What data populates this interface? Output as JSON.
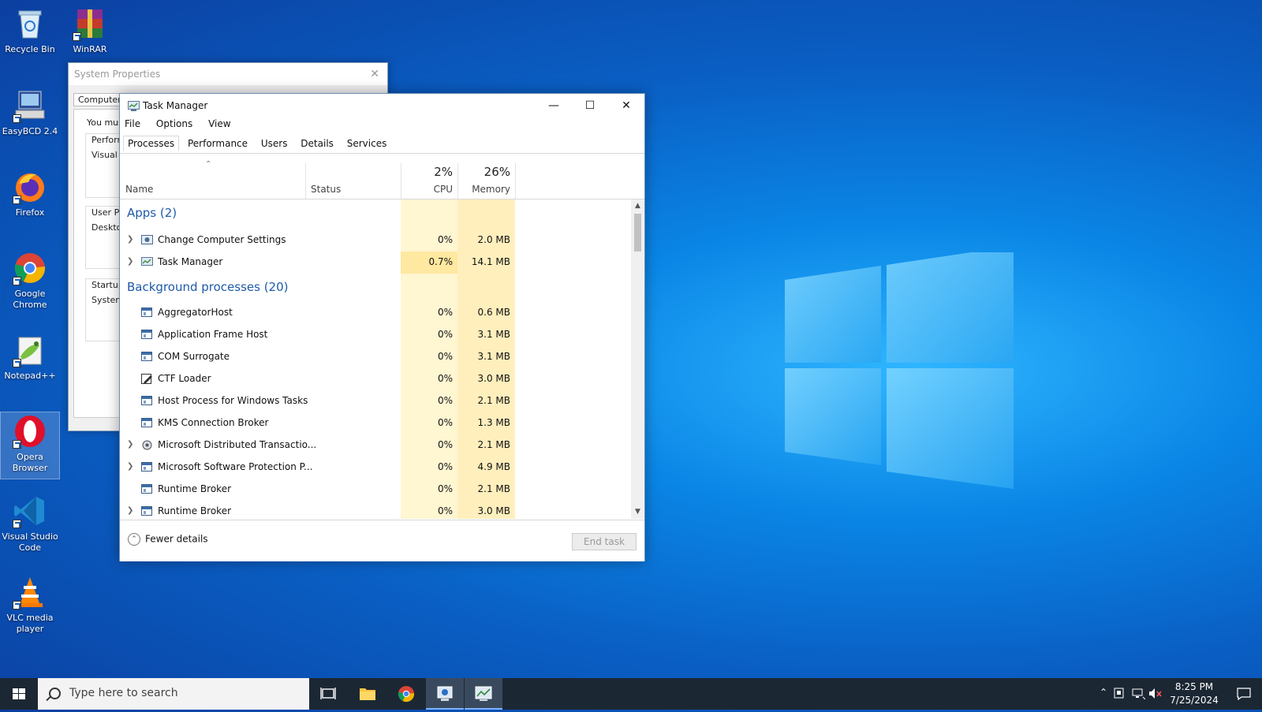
{
  "desktop_icons": [
    {
      "label": "Recycle Bin",
      "icon": "recycle-bin-icon"
    },
    {
      "label": "WinRAR",
      "icon": "winrar-icon"
    },
    {
      "label": "EasyBCD 2.4",
      "icon": "easybcd-icon"
    },
    {
      "label": "Firefox",
      "icon": "firefox-icon"
    },
    {
      "label": "Google Chrome",
      "icon": "chrome-icon"
    },
    {
      "label": "Notepad++",
      "icon": "notepadpp-icon"
    },
    {
      "label": "Opera Browser",
      "icon": "opera-icon"
    },
    {
      "label": "Visual Studio Code",
      "icon": "vscode-icon"
    },
    {
      "label": "VLC media player",
      "icon": "vlc-icon"
    }
  ],
  "system_properties": {
    "title": "System Properties",
    "tab": "Computer N",
    "text_you_must": "You mus",
    "perf_group": "Perform",
    "visual": "Visual e",
    "user_profiles": "User Pr",
    "desktop": "Deskto",
    "startup": "Startup",
    "system": "System"
  },
  "task_manager": {
    "title": "Task Manager",
    "menu": [
      "File",
      "Options",
      "View"
    ],
    "tabs": [
      "Processes",
      "Performance",
      "Users",
      "Details",
      "Services"
    ],
    "active_tab": "Processes",
    "columns": {
      "name": "Name",
      "status": "Status",
      "cpu_total": "2%",
      "cpu": "CPU",
      "memory_total": "26%",
      "memory": "Memory"
    },
    "apps_group": "Apps (2)",
    "apps": [
      {
        "name": "Change Computer Settings",
        "cpu": "0%",
        "memory": "2.0 MB",
        "expandable": true
      },
      {
        "name": "Task Manager",
        "cpu": "0.7%",
        "memory": "14.1 MB",
        "expandable": true
      }
    ],
    "background_group": "Background processes (20)",
    "background": [
      {
        "name": "AggregatorHost",
        "cpu": "0%",
        "memory": "0.6 MB",
        "expandable": false
      },
      {
        "name": "Application Frame Host",
        "cpu": "0%",
        "memory": "3.1 MB",
        "expandable": false
      },
      {
        "name": "COM Surrogate",
        "cpu": "0%",
        "memory": "3.1 MB",
        "expandable": false
      },
      {
        "name": "CTF Loader",
        "cpu": "0%",
        "memory": "3.0 MB",
        "expandable": false
      },
      {
        "name": "Host Process for Windows Tasks",
        "cpu": "0%",
        "memory": "2.1 MB",
        "expandable": false
      },
      {
        "name": "KMS Connection Broker",
        "cpu": "0%",
        "memory": "1.3 MB",
        "expandable": false
      },
      {
        "name": "Microsoft Distributed Transactio...",
        "cpu": "0%",
        "memory": "2.1 MB",
        "expandable": true
      },
      {
        "name": "Microsoft Software Protection P...",
        "cpu": "0%",
        "memory": "4.9 MB",
        "expandable": true
      },
      {
        "name": "Runtime Broker",
        "cpu": "0%",
        "memory": "2.1 MB",
        "expandable": false
      },
      {
        "name": "Runtime Broker",
        "cpu": "0%",
        "memory": "3.0 MB",
        "expandable": true
      }
    ],
    "fewer_details": "Fewer details",
    "end_task": "End task"
  },
  "taskbar": {
    "search_placeholder": "Type here to search",
    "time": "8:25 PM",
    "date": "7/25/2024"
  },
  "colors": {
    "accent": "#1e5aa8",
    "cpu_band": "#fff6d2",
    "memory_band": "#ffefbd",
    "taskbar": "#1c2734"
  }
}
